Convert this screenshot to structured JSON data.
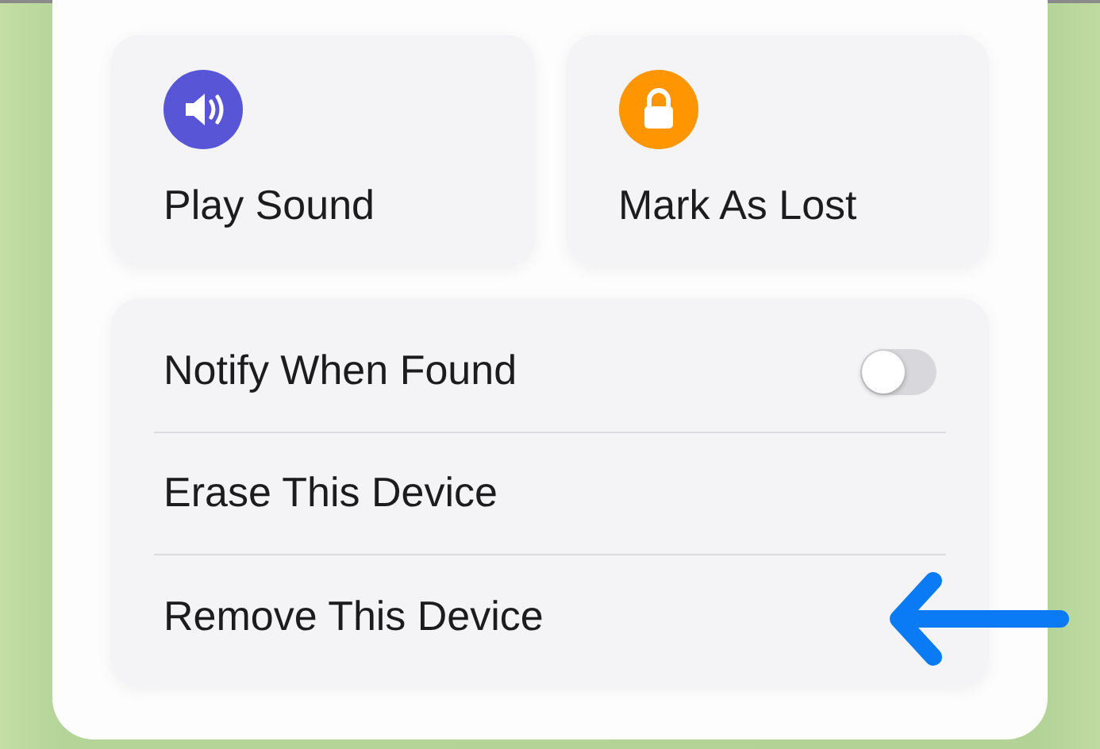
{
  "actions": [
    {
      "label": "Play Sound",
      "kind": "sound",
      "color": "#5856d6"
    },
    {
      "label": "Mark As Lost",
      "kind": "lock",
      "color": "#ff9500"
    }
  ],
  "options": [
    {
      "label": "Notify When Found",
      "kind": "toggle",
      "on": false
    },
    {
      "label": "Erase This Device",
      "kind": "plain"
    },
    {
      "label": "Remove This Device",
      "kind": "plain"
    }
  ]
}
